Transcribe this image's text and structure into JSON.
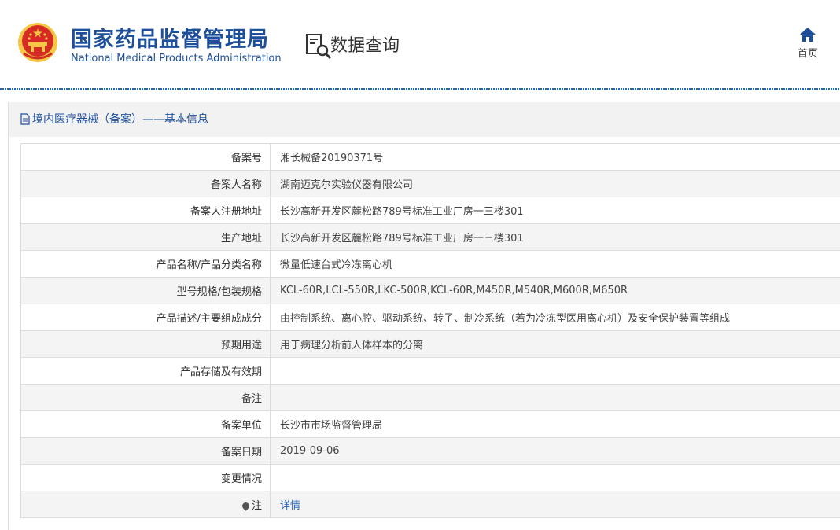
{
  "header": {
    "org_name_cn": "国家药品监督管理局",
    "org_name_en": "National Medical Products Administration",
    "section_title": "数据查询",
    "home_label": "首页"
  },
  "colors": {
    "brand_blue": "#1d4f9b",
    "link_blue": "#2a67b1",
    "emblem_red": "#d62b25",
    "emblem_gold": "#f6c744"
  },
  "icons": {
    "emblem": "national-emblem",
    "data_query": "document-search-icon",
    "home": "home-icon",
    "panel": "document-icon",
    "pin": "pin-icon"
  },
  "panel": {
    "title": "境内医疗器械（备案）——基本信息"
  },
  "rows": [
    {
      "label": "备案号",
      "value": "湘长械备20190371号"
    },
    {
      "label": "备案人名称",
      "value": "湖南迈克尔实验仪器有限公司"
    },
    {
      "label": "备案人注册地址",
      "value": "长沙高新开发区麓松路789号标准工业厂房一三楼301"
    },
    {
      "label": "生产地址",
      "value": "长沙高新开发区麓松路789号标准工业厂房一三楼301"
    },
    {
      "label": "产品名称/产品分类名称",
      "value": "微量低速台式冷冻离心机"
    },
    {
      "label": "型号规格/包装规格",
      "value": "KCL-60R,LCL-550R,LKC-500R,KCL-60R,M450R,M540R,M600R,M650R"
    },
    {
      "label": "产品描述/主要组成成分",
      "value": "由控制系统、离心腔、驱动系统、转子、制冷系统（若为冷冻型医用离心机）及安全保护装置等组成"
    },
    {
      "label": "预期用途",
      "value": "用于病理分析前人体样本的分离"
    },
    {
      "label": "产品存储及有效期",
      "value": ""
    },
    {
      "label": "备注",
      "value": ""
    },
    {
      "label": "备案单位",
      "value": "长沙市市场监督管理局"
    },
    {
      "label": "备案日期",
      "value": "2019-09-06"
    },
    {
      "label": "变更情况",
      "value": ""
    },
    {
      "label": "注",
      "value": "详情"
    }
  ]
}
